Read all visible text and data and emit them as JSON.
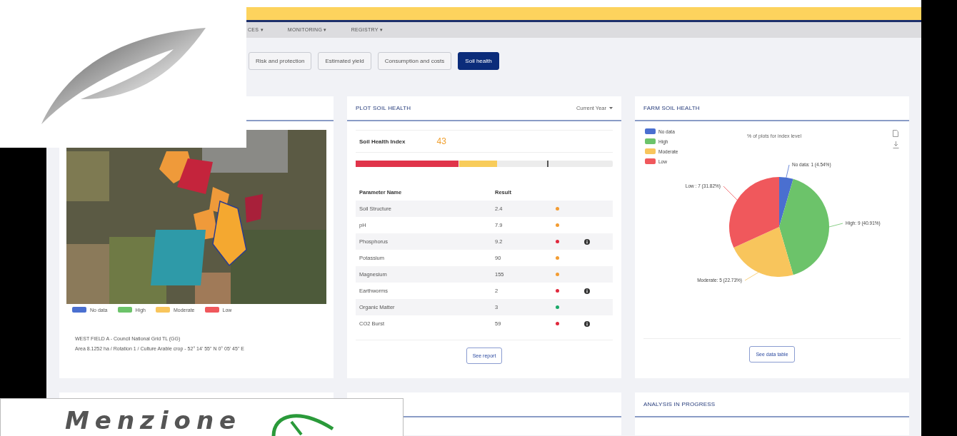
{
  "nav": [
    {
      "label": "CES",
      "caret": "▾"
    },
    {
      "label": "MONITORING",
      "caret": "▾"
    },
    {
      "label": "REGISTRY",
      "caret": "▾"
    }
  ],
  "tabs": [
    {
      "label": "Risk and protection",
      "selected": false
    },
    {
      "label": "Estimated yield",
      "selected": false
    },
    {
      "label": "Consumption and costs",
      "selected": false
    },
    {
      "label": "Soil health",
      "selected": true
    }
  ],
  "map_card": {
    "legend": [
      {
        "label": "No data",
        "color": "#4a6fd0"
      },
      {
        "label": "High",
        "color": "#6cc36a"
      },
      {
        "label": "Moderate",
        "color": "#f8c55c"
      },
      {
        "label": "Low",
        "color": "#f0585c"
      }
    ],
    "plot_title": "WEST FIELD A - Council National Grid TL (GG)",
    "plot_details": "Area 8.1252 ha / Rotation 1 / Culture Arable crop - 52° 14' 55\" N 0° 05' 45\" E"
  },
  "plot_card": {
    "title": "PLOT SOIL HEALTH",
    "period": "Current Year",
    "index_label": "Soil Health Index",
    "index_value": "43",
    "columns": [
      "Parameter Name",
      "Result"
    ],
    "rows": [
      {
        "name": "Soil Structure",
        "result": "2.4",
        "color": "#f39c32",
        "info": false
      },
      {
        "name": "pH",
        "result": "7.9",
        "color": "#f39c32",
        "info": false
      },
      {
        "name": "Phosphorus",
        "result": "9.2",
        "color": "#e0283c",
        "info": true
      },
      {
        "name": "Potassium",
        "result": "90",
        "color": "#f39c32",
        "info": false
      },
      {
        "name": "Magnesium",
        "result": "155",
        "color": "#f39c32",
        "info": false
      },
      {
        "name": "Earthworms",
        "result": "2",
        "color": "#e0283c",
        "info": true
      },
      {
        "name": "Organic Matter",
        "result": "3",
        "color": "#1aa868",
        "info": false
      },
      {
        "name": "CO2 Burst",
        "result": "59",
        "color": "#e0283c",
        "info": true
      }
    ],
    "button": "See report"
  },
  "farm_card": {
    "title": "FARM SOIL HEALTH",
    "chart_data": {
      "type": "pie",
      "title": "% of plots for index level",
      "categories": [
        "No data",
        "High",
        "Moderate",
        "Low"
      ],
      "values": [
        4.54,
        40.91,
        22.73,
        31.82
      ],
      "legend": "top-left",
      "colors": [
        "#4a6fd0",
        "#6cc36a",
        "#f8c55c",
        "#f0585c"
      ],
      "value_labels": [
        "No data: 1 (4.54%)",
        "High: 9 (40.91%)",
        "Moderate: 5 (22.73%)",
        "Low : 7 (31.82%)"
      ]
    },
    "button": "See data table"
  },
  "bottom_cards": [
    {
      "kind": "blank"
    },
    {
      "kind": "blank"
    },
    {
      "kind": "titled",
      "title": "ANALYSIS IN PROGRESS"
    }
  ],
  "badge": {
    "text": "Menzione"
  }
}
